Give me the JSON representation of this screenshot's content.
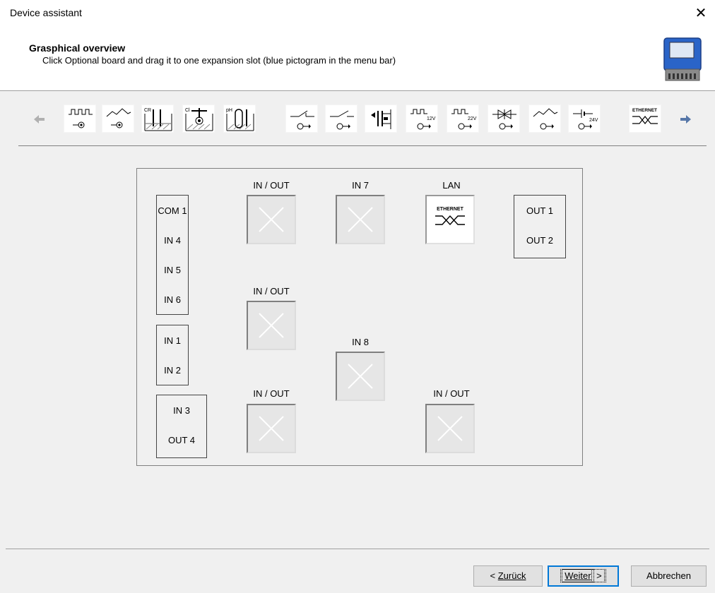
{
  "window": {
    "title": "Device assistant",
    "close_glyph": "✕"
  },
  "header": {
    "title": "Grasphical overview",
    "subtitle": "Click Optional board and drag it to one expansion slot (blue pictogram in the menu bar)",
    "logo_icon": "controller-device-icon"
  },
  "toolbar": {
    "left_arrow_icon": "arrow-left-icon",
    "right_arrow_icon": "arrow-right-icon",
    "items": [
      {
        "icon": "pulse-input-icon",
        "caption": ""
      },
      {
        "icon": "analog-input-icon",
        "caption": ""
      },
      {
        "icon": "cr-sensor-icon",
        "caption": "CR"
      },
      {
        "icon": "cl-sensor-icon",
        "caption": "Cl"
      },
      {
        "icon": "ph-sensor-icon",
        "caption": "pH"
      },
      {
        "icon": "contact-nc-output-icon",
        "caption": ""
      },
      {
        "icon": "contact-no-output-icon",
        "caption": ""
      },
      {
        "icon": "transistor-output-icon",
        "caption": ""
      },
      {
        "icon": "pulse-12v-output-icon",
        "caption": "12V"
      },
      {
        "icon": "pulse-22v-output-icon",
        "caption": "22V"
      },
      {
        "icon": "triac-output-icon",
        "caption": ""
      },
      {
        "icon": "analog-output-icon",
        "caption": ""
      },
      {
        "icon": "dc-24v-output-icon",
        "caption": "24V"
      },
      {
        "icon": "ethernet-module-icon",
        "caption": "ETHERNET"
      }
    ]
  },
  "board": {
    "group1": [
      "COM 1",
      "IN 4",
      "IN 5",
      "IN 6"
    ],
    "group2": [
      "IN 1",
      "IN 2"
    ],
    "group3": [
      "IN 3",
      "OUT 4"
    ],
    "group4": [
      "OUT 1",
      "OUT 2"
    ],
    "slots": {
      "io1": "IN / OUT",
      "io2": "IN / OUT",
      "io3": "IN / OUT",
      "in7": "IN 7",
      "in8": "IN 8",
      "lan": "LAN",
      "io4": "IN / OUT"
    },
    "lan_module_caption": "ETHERNET"
  },
  "footer": {
    "back_prefix": "< ",
    "back_label": "Zurück",
    "next_label": "Weiter",
    "next_suffix": " >",
    "cancel_label": "Abbrechen"
  }
}
